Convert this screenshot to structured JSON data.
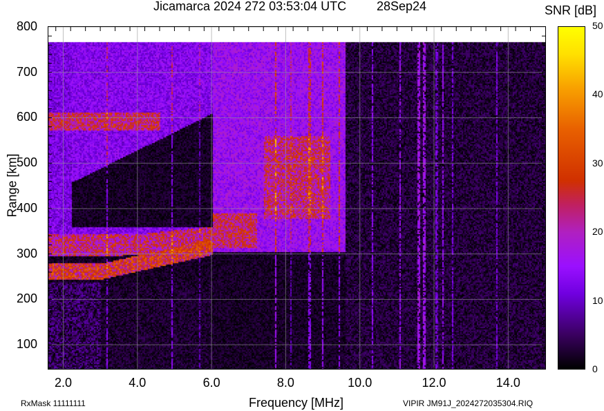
{
  "header": {
    "title": "Jicamarca 2024 272 03:53:04 UTC",
    "date": "28Sep24"
  },
  "footer": {
    "rxmask": "RxMask 11111111",
    "file": "VIPIR  JM91J_2024272035304.RIQ"
  },
  "chart_data": {
    "type": "heatmap",
    "title": "Jicamarca 2024 272 03:53:04 UTC",
    "xlabel": "Frequency [MHz]",
    "ylabel": "Range [km]",
    "xlim": [
      1.6,
      15.0
    ],
    "ylim": [
      47,
      800
    ],
    "data_ylim": [
      47,
      767
    ],
    "xticks": [
      "2.0",
      "4.0",
      "6.0",
      "8.0",
      "10.0",
      "12.0",
      "14.0"
    ],
    "xtick_values": [
      2,
      4,
      6,
      8,
      10,
      12,
      14
    ],
    "yticks": [
      "800",
      "700",
      "600",
      "500",
      "400",
      "300",
      "200",
      "100"
    ],
    "ytick_values": [
      800,
      700,
      600,
      500,
      400,
      300,
      200,
      100
    ],
    "grid": true,
    "colorbar": {
      "label": "SNR [dB]",
      "range": [
        0,
        50
      ],
      "ticks": [
        "50",
        "40",
        "30",
        "20",
        "10",
        "0"
      ],
      "tick_values": [
        50,
        40,
        30,
        20,
        10,
        0
      ]
    },
    "colors": {
      "low": "#000000",
      "mid": "#8000ff",
      "high": "#ffff00"
    },
    "features": [
      {
        "name": "F-trace lower",
        "freq_mhz": [
          1.7,
          6.0
        ],
        "range_km": [
          [
            245,
            290
          ],
          [
            300,
            310
          ]
        ],
        "snr_db": 35
      },
      {
        "name": "F-trace second",
        "freq_mhz": [
          1.7,
          6.0
        ],
        "range_km": [
          [
            290,
            350
          ],
          [
            300,
            360
          ]
        ],
        "snr_db": 25
      },
      {
        "name": "second hop",
        "freq_mhz": [
          1.7,
          4.5
        ],
        "range_km": [
          [
            570,
            610
          ],
          [
            580,
            620
          ]
        ],
        "snr_db": 30
      },
      {
        "name": "spread F upper",
        "freq_mhz": [
          1.7,
          6.0
        ],
        "range_km_lower_edge": [
          450,
          610
        ],
        "snr_db": 14
      },
      {
        "name": "spread F high freq",
        "freq_mhz": [
          6.0,
          9.5
        ],
        "range_km": [
          305,
          767
        ],
        "snr_db": 16
      },
      {
        "name": "bright blobs",
        "freq_mhz": [
          7.3,
          9.2
        ],
        "range_km": [
          380,
          560
        ],
        "snr_db": 30
      }
    ]
  }
}
